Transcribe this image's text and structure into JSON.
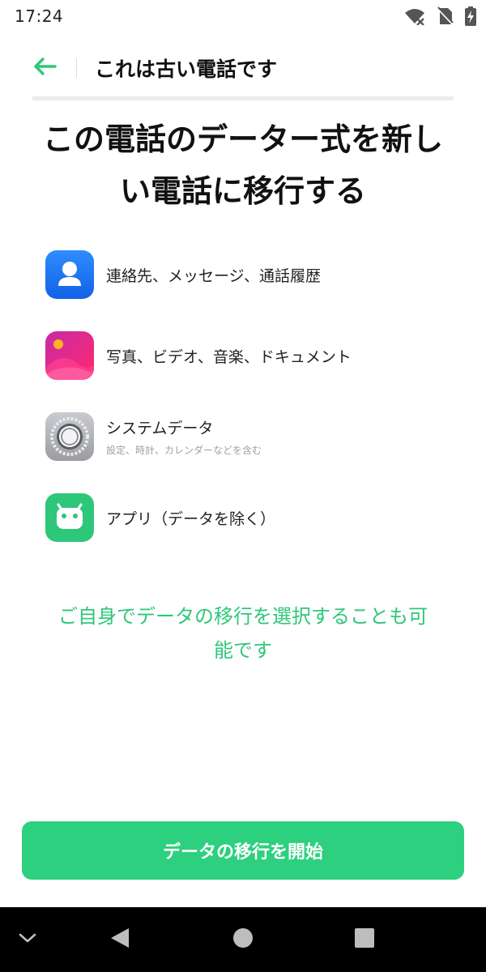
{
  "status_bar": {
    "time": "17:24",
    "icons": [
      "wifi-off-icon",
      "no-sim-icon",
      "battery-charging-icon"
    ]
  },
  "header": {
    "back_icon": "arrow-left-icon",
    "title": "これは古い電話です"
  },
  "headline": {
    "line1": "この電話のデーター式を新し",
    "line2": "い電話に移行する"
  },
  "data_items": [
    {
      "icon": "contacts-icon",
      "label": "連絡先、メッセージ、通話履歴",
      "sublabel": ""
    },
    {
      "icon": "photos-icon",
      "label": "写真、ビデオ、音楽、ドキュメント",
      "sublabel": ""
    },
    {
      "icon": "settings-icon",
      "label": "システムデータ",
      "sublabel": "設定、時計、カレンダーなどを含む"
    },
    {
      "icon": "android-apps-icon",
      "label": "アプリ（データを除く）",
      "sublabel": ""
    }
  ],
  "select_link": {
    "line1": "ご自身でデータの移行を選択することも可",
    "line2": "能です"
  },
  "primary_button": {
    "label": "データの移行を開始"
  },
  "nav_bar": {
    "icons": [
      "chevron-down-icon",
      "back-triangle-icon",
      "home-circle-icon",
      "recents-square-icon"
    ]
  },
  "colors": {
    "accent": "#2ec77a",
    "button": "#2dd07f",
    "contacts_icon": "#1f76f5",
    "media_icon": "#e0287f",
    "system_icon": "#a9abb0",
    "apps_icon": "#2ec77a"
  }
}
